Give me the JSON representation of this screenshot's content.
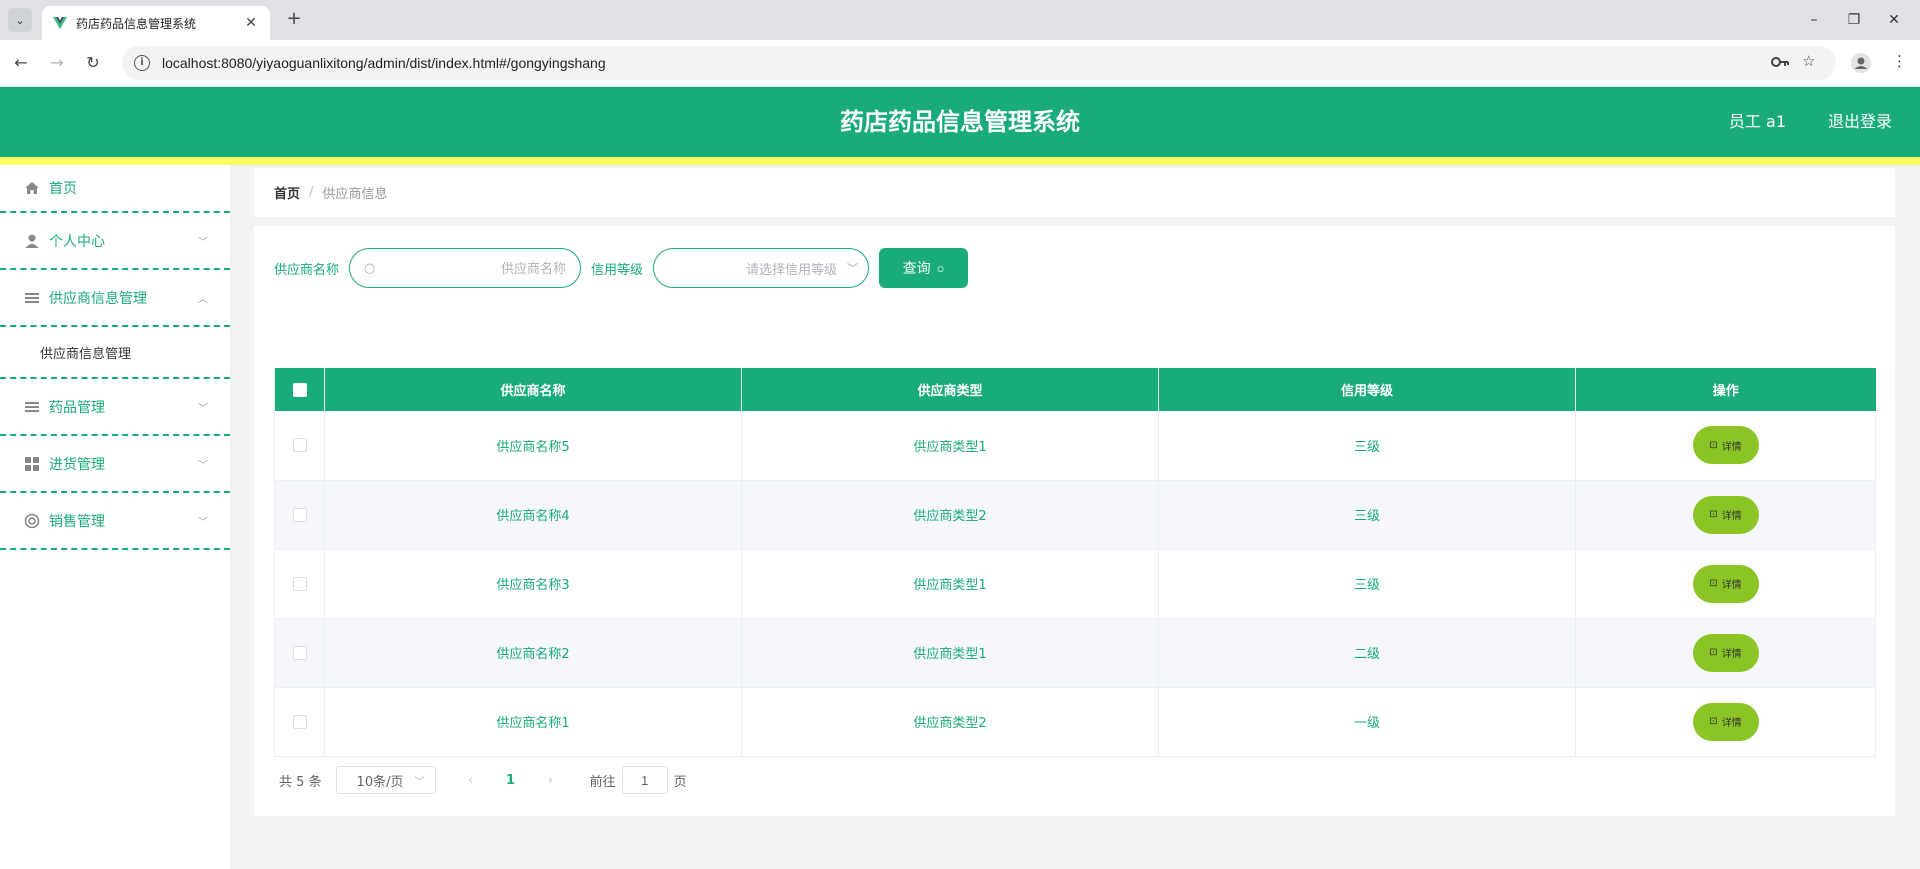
{
  "browser": {
    "tab_title": "药店药品信息管理系统",
    "url": "localhost:8080/yiyaoguanlixitong/admin/dist/index.html#/gongyingshang"
  },
  "header": {
    "title": "药店药品信息管理系统",
    "user": "员工 a1",
    "logout": "退出登录"
  },
  "sidebar": {
    "home": "首页",
    "items": [
      {
        "label": "个人中心",
        "icon": "person-icon"
      },
      {
        "label": "供应商信息管理",
        "icon": "list-icon",
        "expanded": true,
        "sub": "供应商信息管理"
      },
      {
        "label": "药品管理",
        "icon": "list-icon"
      },
      {
        "label": "进货管理",
        "icon": "grid-icon"
      },
      {
        "label": "销售管理",
        "icon": "lifebuoy-icon"
      }
    ]
  },
  "breadcrumb": {
    "home": "首页",
    "sep": "/",
    "current": "供应商信息"
  },
  "search": {
    "name_label": "供应商名称",
    "name_placeholder": "供应商名称",
    "credit_label": "信用等级",
    "credit_placeholder": "请选择信用等级",
    "query_label": "查询"
  },
  "table": {
    "headers": [
      "供应商名称",
      "供应商类型",
      "信用等级",
      "操作"
    ],
    "detail_label": "详情",
    "rows": [
      {
        "name": "供应商名称5",
        "type": "供应商类型1",
        "credit": "三级"
      },
      {
        "name": "供应商名称4",
        "type": "供应商类型2",
        "credit": "三级"
      },
      {
        "name": "供应商名称3",
        "type": "供应商类型1",
        "credit": "三级"
      },
      {
        "name": "供应商名称2",
        "type": "供应商类型1",
        "credit": "二级"
      },
      {
        "name": "供应商名称1",
        "type": "供应商类型2",
        "credit": "一级"
      }
    ]
  },
  "pager": {
    "total": "共 5 条",
    "size": "10条/页",
    "page": "1",
    "goto": "前往",
    "goto_value": "1",
    "page_suffix": "页"
  },
  "colors": {
    "primary": "#1aab7a",
    "strip": "#f7fd63",
    "detail_button": "#8bc425"
  }
}
